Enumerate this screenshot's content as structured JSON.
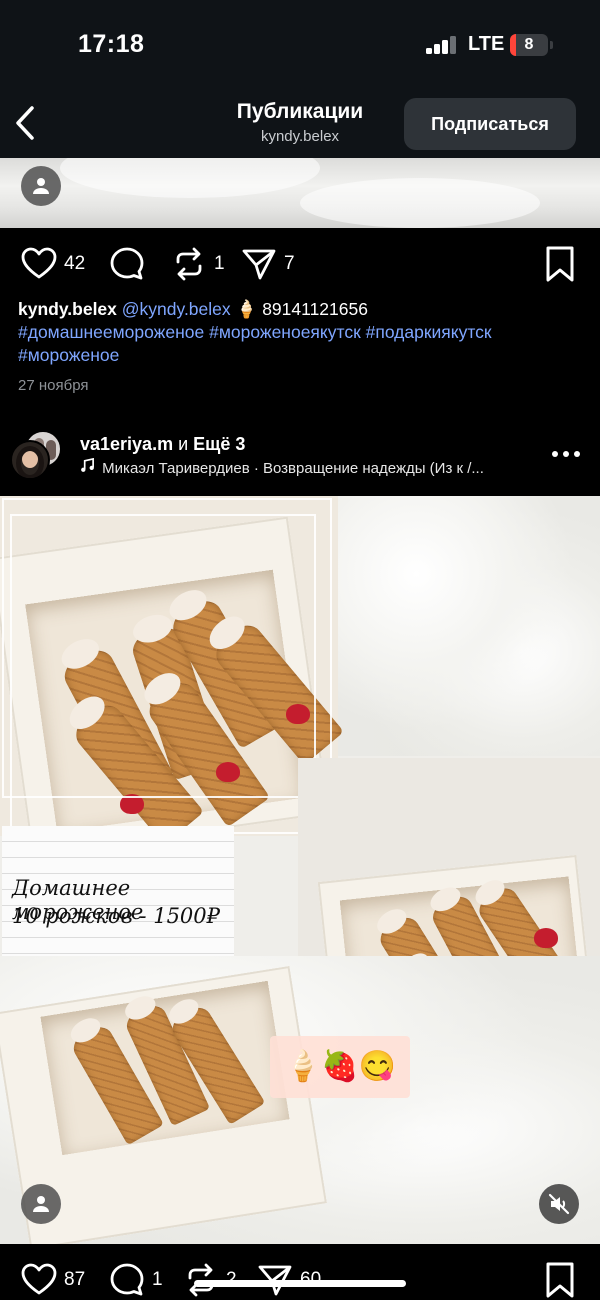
{
  "status_bar": {
    "time": "17:18",
    "network": "LTE",
    "battery": "8"
  },
  "header": {
    "title": "Публикации",
    "subtitle": "kyndy.belex",
    "subscribe_label": "Подписаться"
  },
  "post1": {
    "likes": "42",
    "reposts": "1",
    "shares": "7",
    "caption": {
      "username": "kyndy.belex",
      "mention": "@kyndy.belex",
      "emoji": "🍦",
      "phone": "89141121656",
      "tags": [
        "#домашнеемороженое",
        "#мороженоеякутск",
        "#подаркиякутск",
        "#мороженое"
      ]
    },
    "date": "27 ноября"
  },
  "post2": {
    "author": "va1eriya.m",
    "author_joiner": "и",
    "author_more": "Ещё 3",
    "music": "Микаэл Таривердиев · Возвращение надежды (Из к /...",
    "note_line1": "Домашнее мороженое",
    "note_line2": "10 рожков - 1500₽",
    "emojis": "🍦🍓😋",
    "likes": "87",
    "comments": "1",
    "reposts": "2",
    "shares": "60"
  },
  "colors": {
    "background": "#000000",
    "header": "#0f1317",
    "hashtag": "#7fa6ff",
    "muted": "#8e9297",
    "button": "#2e3338"
  }
}
